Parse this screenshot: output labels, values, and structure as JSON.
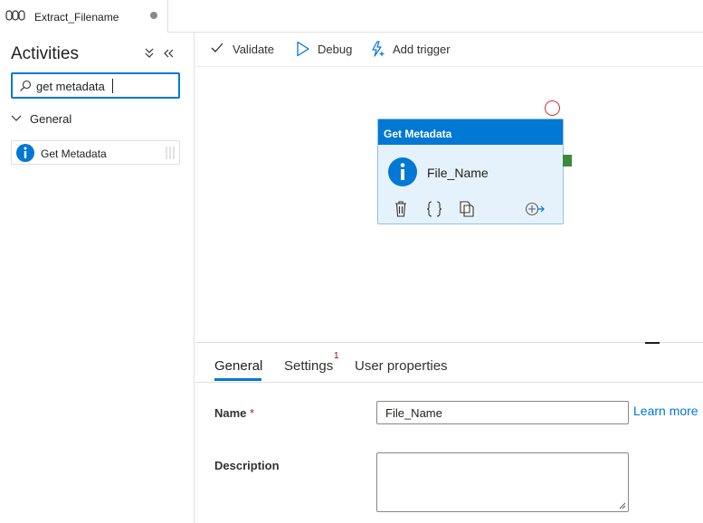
{
  "tab": {
    "title": "Extract_Filename",
    "icon": "pipeline-icon",
    "unsaved_indicator": "modified-dot-icon"
  },
  "activities_panel": {
    "title": "Activities",
    "collapse_icon": "collapse-all-icon",
    "hide_icon": "double-chevron-left-icon",
    "search": {
      "value": "get metadata",
      "icon": "search-icon"
    },
    "group": {
      "label": "General",
      "expanded": true,
      "icon": "chevron-down-icon"
    },
    "items": [
      {
        "label": "Get Metadata",
        "icon": "info-icon"
      }
    ]
  },
  "toolbar": {
    "validate_label": "Validate",
    "debug_label": "Debug",
    "add_trigger_label": "Add trigger"
  },
  "canvas": {
    "node": {
      "type_label": "Get Metadata",
      "name": "File_Name",
      "icon": "info-icon",
      "actions": [
        "delete-icon",
        "code-icon",
        "copy-icon",
        "add-output-icon"
      ]
    }
  },
  "properties": {
    "tabs": [
      {
        "label": "General",
        "active": true
      },
      {
        "label": "Settings",
        "badge": "1"
      },
      {
        "label": "User properties"
      }
    ],
    "name_label": "Name",
    "required_marker": "*",
    "name_value": "File_Name",
    "learn_more": "Learn more",
    "description_label": "Description",
    "description_value": ""
  },
  "colors": {
    "accent": "#0078d4",
    "node_body": "#e6f2fb",
    "success_port": "#3c8a3c",
    "failure_port": "#d13438"
  }
}
